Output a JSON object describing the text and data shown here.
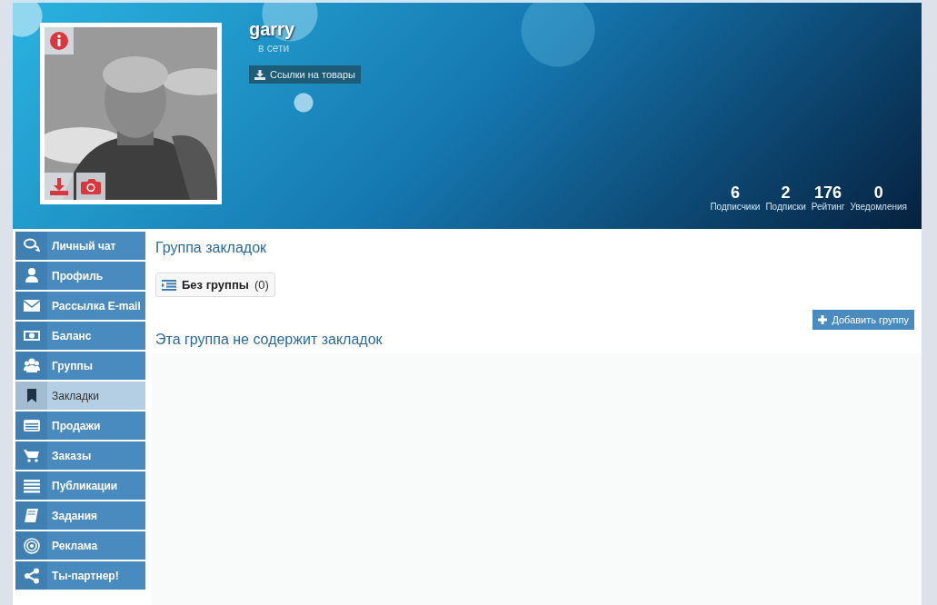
{
  "profile": {
    "username": "garry",
    "status": "в сети",
    "links_button": "Ссылки на товары",
    "stats": [
      {
        "value": "6",
        "label": "Подписчики"
      },
      {
        "value": "2",
        "label": "Подписки"
      },
      {
        "value": "176",
        "label": "Рейтинг"
      },
      {
        "value": "0",
        "label": "Уведомления"
      }
    ]
  },
  "sidebar": {
    "items": [
      {
        "label": "Личный чат",
        "kind": "chat",
        "selected": false
      },
      {
        "label": "Профиль",
        "kind": "user",
        "selected": false
      },
      {
        "label": "Рассылка E-mail",
        "kind": "mail",
        "selected": false
      },
      {
        "label": "Баланс",
        "kind": "money",
        "selected": false
      },
      {
        "label": "Группы",
        "kind": "group",
        "selected": false
      },
      {
        "label": "Закладки",
        "kind": "bookmark",
        "selected": true
      },
      {
        "label": "Продажи",
        "kind": "card",
        "selected": false
      },
      {
        "label": "Заказы",
        "kind": "cart",
        "selected": false
      },
      {
        "label": "Публикации",
        "kind": "list",
        "selected": false
      },
      {
        "label": "Задания",
        "kind": "book",
        "selected": false
      },
      {
        "label": "Реклама",
        "kind": "target",
        "selected": false
      },
      {
        "label": "Ты-партнер!",
        "kind": "share",
        "selected": false
      }
    ]
  },
  "content": {
    "title": "Группа закладок",
    "groups": [
      {
        "name": "Без группы",
        "count": "(0)"
      }
    ],
    "add_button": "Добавить группу",
    "empty_message": "Эта группа не содержит закладок"
  }
}
